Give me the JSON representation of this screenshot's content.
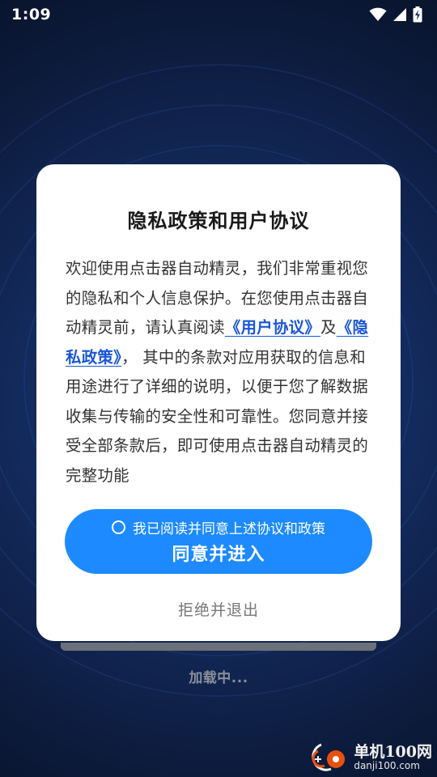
{
  "status_bar": {
    "time": "1:09",
    "icons": [
      "wifi-icon",
      "cell-signal-icon",
      "battery-charging-icon"
    ]
  },
  "dialog": {
    "title": "隐私政策和用户协议",
    "body_part1": "欢迎使用点击器自动精灵，我们非常重视您的隐私和个人信息保护。在您使用点击器自动精灵前，请认真阅读",
    "user_agreement_link": "《用户协议》",
    "and_word": "及",
    "privacy_policy_link": "《隐私政策》",
    "body_part2": "， 其中的条款对应用获取的信息和用途进行了详细的说明，以便于您了解数据收集与传输的安全性和可靠性。您同意并接受全部条款后，即可使用点击器自动精灵的完整功能",
    "checkbox_label": "我已阅读并同意上述协议和政策",
    "checkbox_checked": false,
    "agree_button_label": "同意并进入",
    "reject_button_label": "拒绝并退出"
  },
  "loading": {
    "text": "加载中...",
    "progress": 1.0
  },
  "watermark": {
    "title": "单机100网",
    "url": "danji100.com"
  },
  "colors": {
    "accent": "#1d8bff",
    "link": "#1a56d6",
    "background_dark": "#0b1835"
  }
}
